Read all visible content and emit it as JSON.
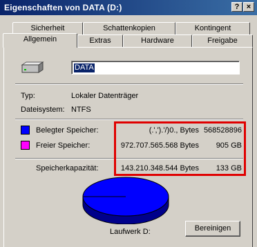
{
  "window": {
    "title": "Eigenschaften von DATA (D:)",
    "help_label": "?",
    "close_label": "×"
  },
  "tabs": {
    "row1": [
      "Sicherheit",
      "Schattenkopien",
      "Kontingent"
    ],
    "row2": [
      "Allgemein",
      "Extras",
      "Hardware",
      "Freigabe"
    ],
    "active": "Allgemein"
  },
  "drive": {
    "icon": "hard-drive-icon",
    "name": "DATA",
    "type_label": "Typ:",
    "type_value": "Lokaler Datenträger",
    "fs_label": "Dateisystem:",
    "fs_value": "NTFS"
  },
  "usage": {
    "used": {
      "label": "Belegter Speicher:",
      "bytes": "(.',').'/)0., Bytes",
      "size": "568528896",
      "color": "#0000ff"
    },
    "free": {
      "label": "Freier Speicher:",
      "bytes": "972.707.565.568 Bytes",
      "size": "905 GB",
      "color": "#ff00ff"
    },
    "capacity": {
      "label": "Speicherkapazität:",
      "bytes": "143.210.348.544 Bytes",
      "size": "133 GB"
    }
  },
  "chart": {
    "used_color": "#0000ff",
    "side_color": "#00008b",
    "drive_label": "Laufwerk D:"
  },
  "cleanup_button": "Bereinigen",
  "highlight_color": "#e00000"
}
